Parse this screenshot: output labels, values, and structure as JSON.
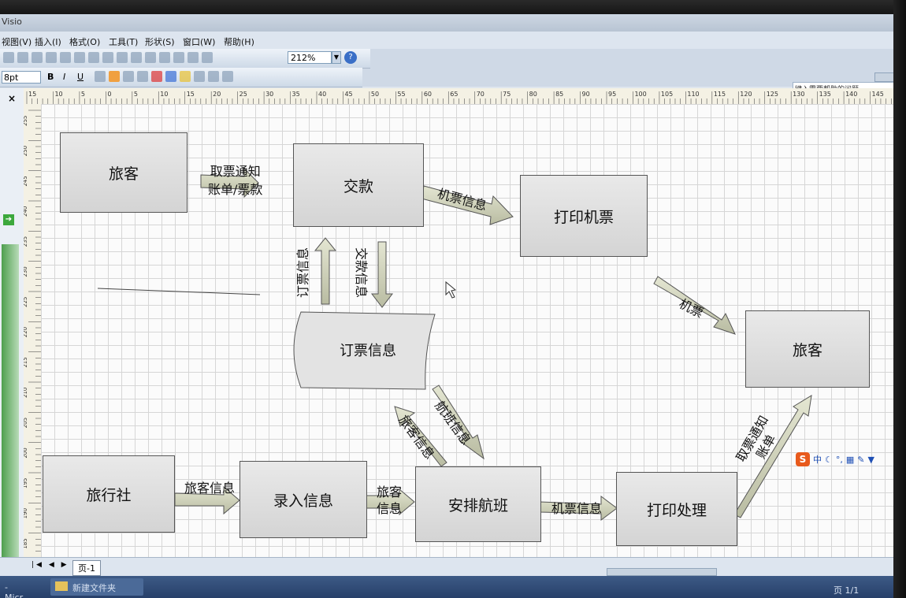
{
  "window": {
    "title": "Visio",
    "help_placeholder": "键入需要帮助的问题"
  },
  "menu": [
    "视图(V)",
    "插入(I)",
    "格式(O)",
    "工具(T)",
    "形状(S)",
    "窗口(W)",
    "帮助(H)"
  ],
  "toolbar": {
    "zoom": "212%",
    "font_size": "8pt",
    "bold": "B",
    "italic": "I",
    "underline": "U",
    "help": "?"
  },
  "panel": {
    "close": "×"
  },
  "ruler": {
    "h_ticks": [
      "15",
      "10",
      "5",
      "0",
      "5",
      "10",
      "15",
      "20",
      "25",
      "30",
      "35",
      "40",
      "45",
      "50",
      "55",
      "60",
      "65",
      "70",
      "75",
      "80",
      "85",
      "90",
      "95",
      "100",
      "105",
      "110",
      "115",
      "120",
      "125",
      "130",
      "135",
      "140",
      "145"
    ],
    "v_ticks": [
      "255",
      "250",
      "245",
      "240",
      "235",
      "230",
      "225",
      "220",
      "215",
      "210",
      "205",
      "200",
      "195",
      "190",
      "185"
    ]
  },
  "diagram": {
    "nodes": {
      "passenger_top": "旅客",
      "payment": "交款",
      "print_ticket": "打印机票",
      "booking_store": "订票信息",
      "passenger_right": "旅客",
      "agency": "旅行社",
      "enter_info": "录入信息",
      "arrange_flight": "安排航班",
      "print_process": "打印处理"
    },
    "flows": {
      "notice_bill": "取票通知\n账单/票款",
      "ticket_info_1": "机票信息",
      "booking_info_up": "订票信息",
      "payment_info_down": "交款信息",
      "ticket": "机票",
      "passenger_info_up": "旅客信息",
      "flight_info": "航班信息",
      "passenger_info_agency": "旅客信息",
      "passenger_info_enter": "旅客\n信息",
      "ticket_info_2": "机票信息",
      "notice_bill_2": "取票通知\n账单"
    }
  },
  "status": {
    "page_tab": "页-1",
    "page_info": "页 1/1",
    "task_item_1": "- Micr...",
    "task_item_2": "新建文件夹"
  },
  "ime": {
    "logo": "S",
    "mode": "中"
  }
}
